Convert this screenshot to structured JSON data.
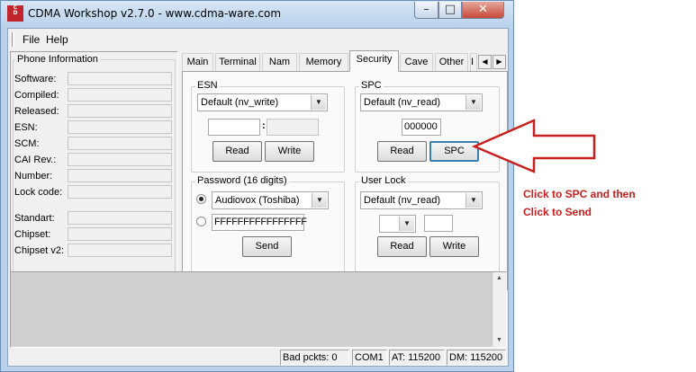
{
  "window": {
    "title": "CDMA Workshop v2.7.0  -  www.cdma-ware.com",
    "logo_letters": [
      "C",
      "D",
      "M",
      "A"
    ],
    "controls": {
      "minimize": "–",
      "maximize": "□",
      "close": "✕"
    }
  },
  "menu": {
    "file": "File",
    "help": "Help"
  },
  "phone_info": {
    "title": "Phone Information",
    "fields": [
      "Software:",
      "Compiled:",
      "Released:",
      "ESN:",
      "SCM:",
      "CAI Rev.:",
      "Number:",
      "Lock code:"
    ],
    "chip_fields": [
      "Standart:",
      "Chipset:",
      "Chipset v2:"
    ]
  },
  "tabs": [
    "Main",
    "Terminal",
    "Nam",
    "Memory",
    "Security",
    "Cave",
    "Other",
    "I"
  ],
  "active_tab": "Security",
  "esn": {
    "title": "ESN",
    "mode": "Default (nv_write)",
    "separator": ":",
    "read": "Read",
    "write": "Write"
  },
  "spc": {
    "title": "SPC",
    "mode": "Default (nv_read)",
    "value": "000000",
    "read": "Read",
    "spc_button": "SPC"
  },
  "password": {
    "title": "Password (16 digits)",
    "device": "Audiovox (Toshiba)",
    "value": "FFFFFFFFFFFFFFFF",
    "send": "Send",
    "selected_option": "device"
  },
  "user_lock": {
    "title": "User Lock",
    "mode": "Default (nv_read)",
    "read": "Read",
    "write": "Write"
  },
  "statusbar": {
    "bad_packets": "Bad pckts: 0",
    "port": "COM1",
    "at_speed": "AT: 115200",
    "dm_speed": "DM: 115200"
  },
  "annotation": {
    "line1": "Click to SPC and then",
    "line2": "Click to Send",
    "color": "#c8201e"
  }
}
